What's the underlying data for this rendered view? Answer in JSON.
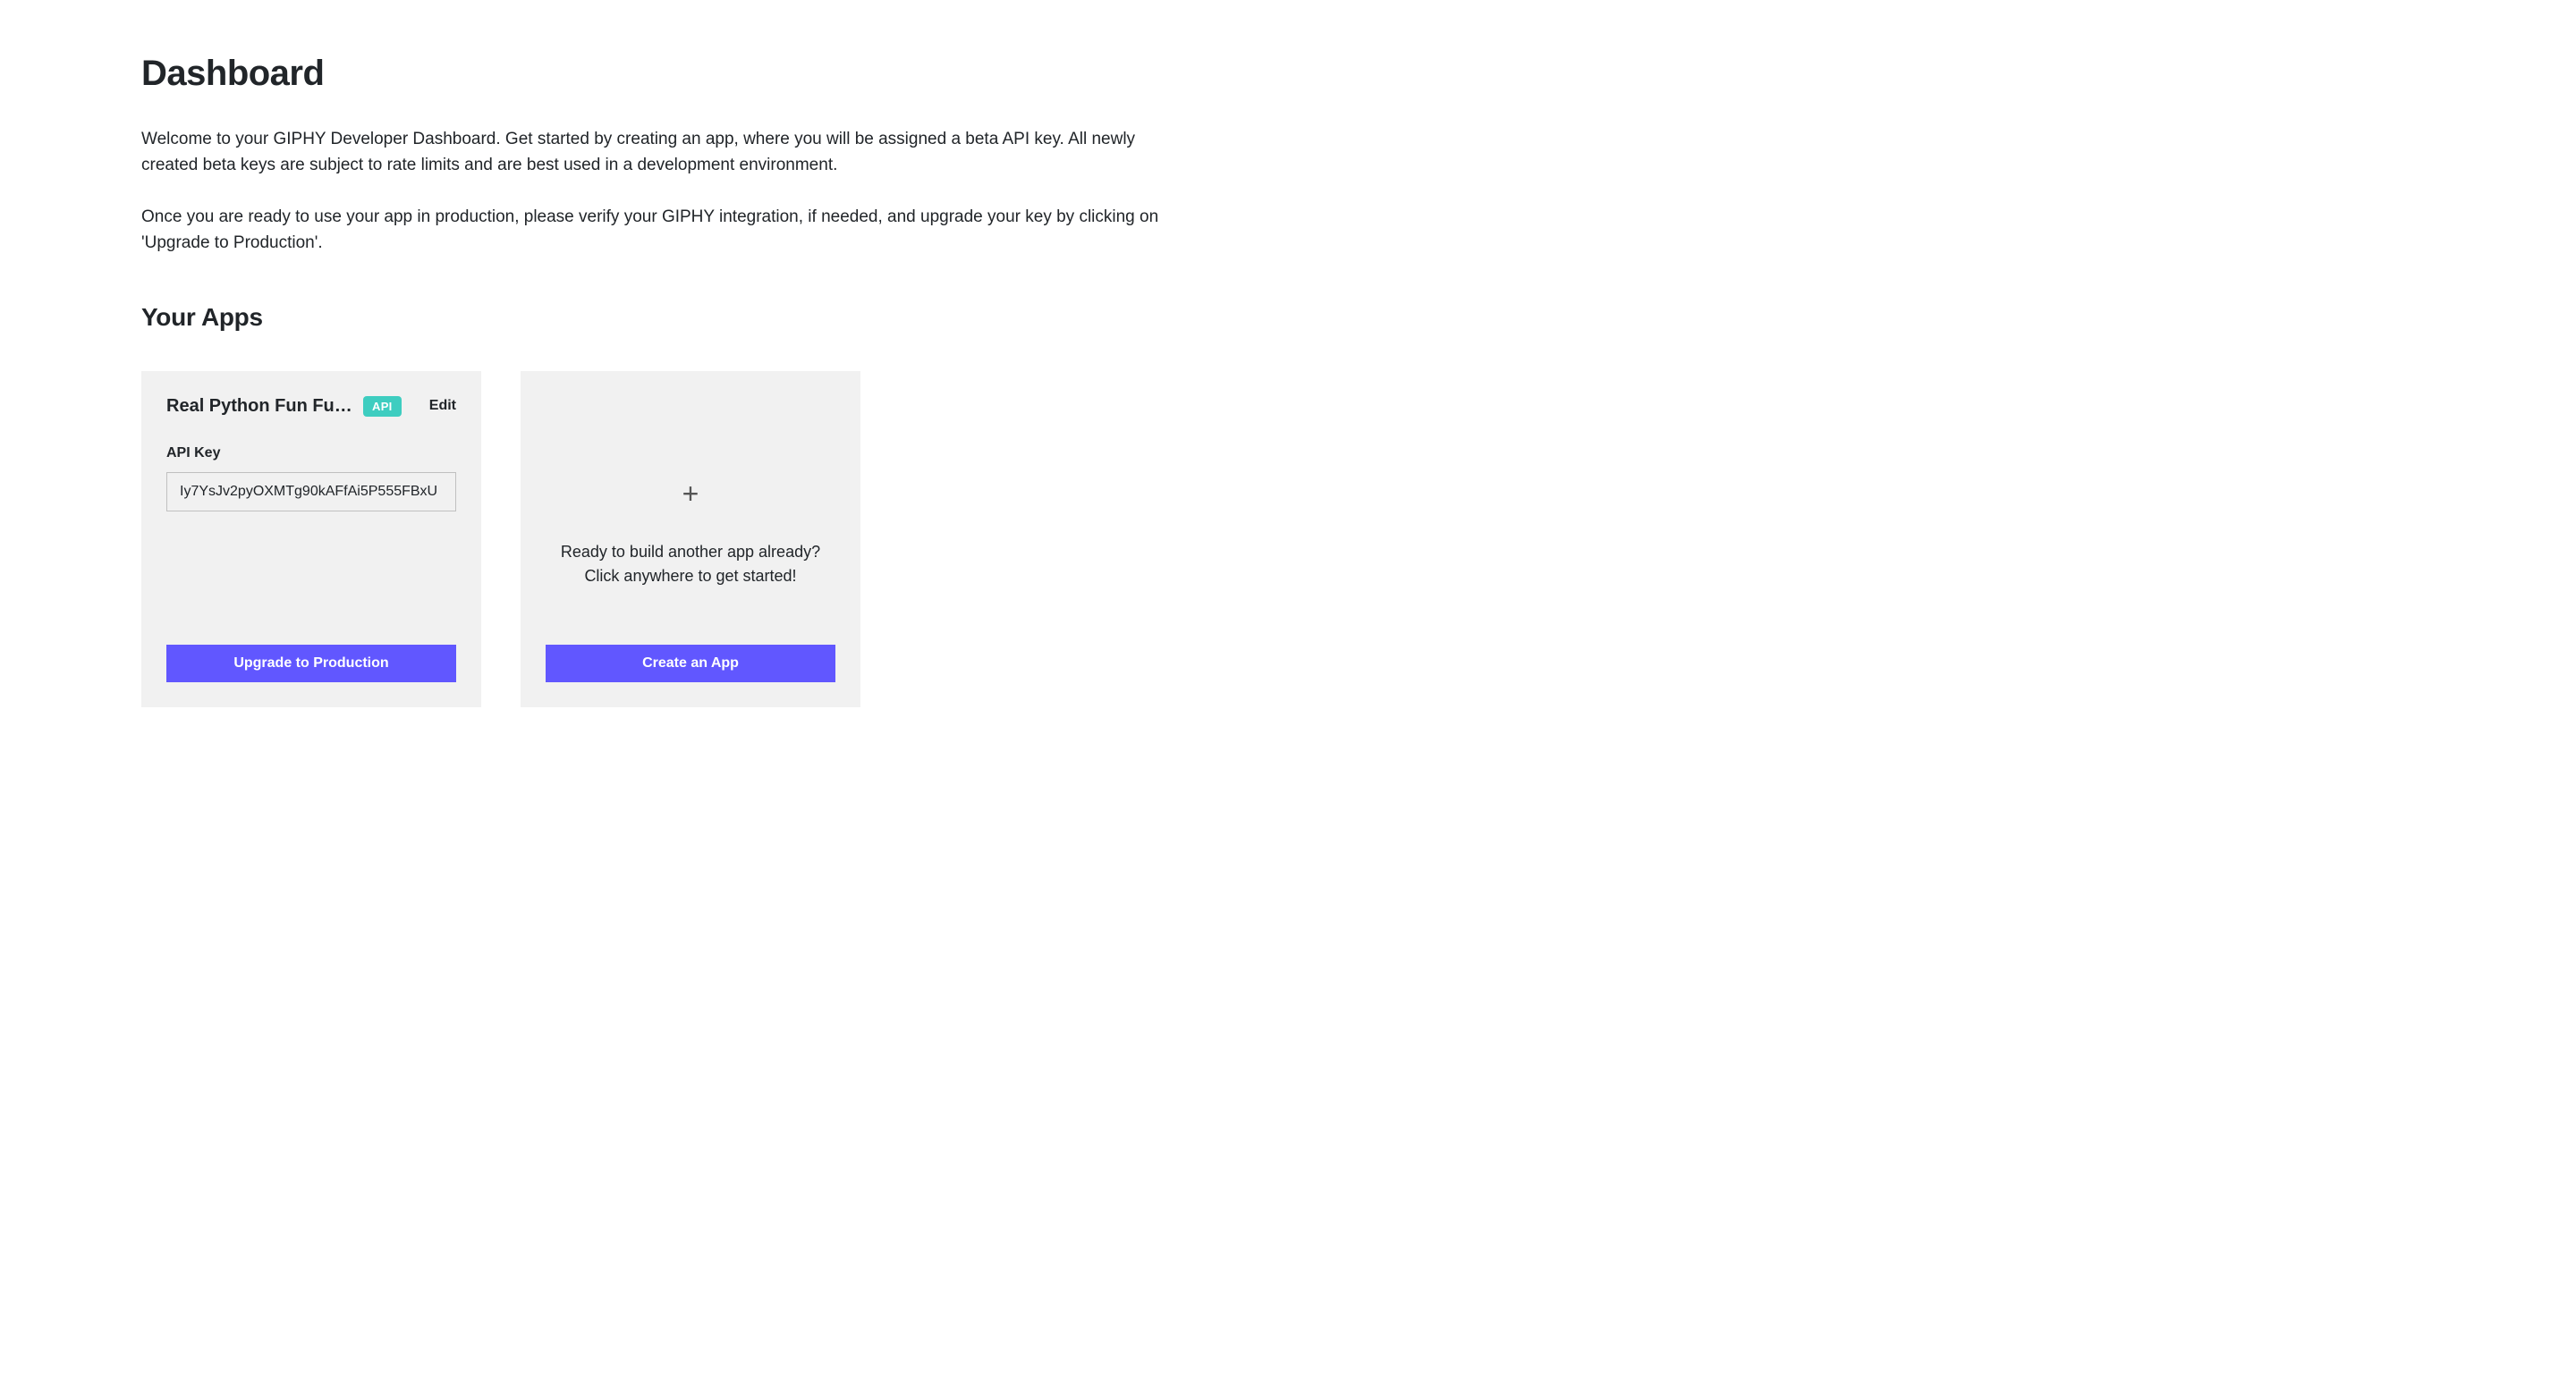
{
  "header": {
    "title": "Dashboard",
    "intro_paragraph_1": "Welcome to your GIPHY Developer Dashboard. Get started by creating an app, where you will be assigned a beta API key. All newly created beta keys are subject to rate limits and are best used in a development environment.",
    "intro_paragraph_2": "Once you are ready to use your app in production, please verify your GIPHY integration, if needed, and upgrade your key by clicking on 'Upgrade to Production'."
  },
  "apps_section": {
    "title": "Your Apps"
  },
  "app_card": {
    "name": "Real Python Fun Fun F…",
    "badge": "API",
    "edit_label": "Edit",
    "api_key_label": "API Key",
    "api_key_value": "Iy7YsJv2pyOXMTg90kAFfAi5P555FBxU",
    "upgrade_button": "Upgrade to Production"
  },
  "create_card": {
    "prompt_line_1": "Ready to build another app already?",
    "prompt_line_2": "Click anywhere to get started!",
    "create_button": "Create an App"
  }
}
